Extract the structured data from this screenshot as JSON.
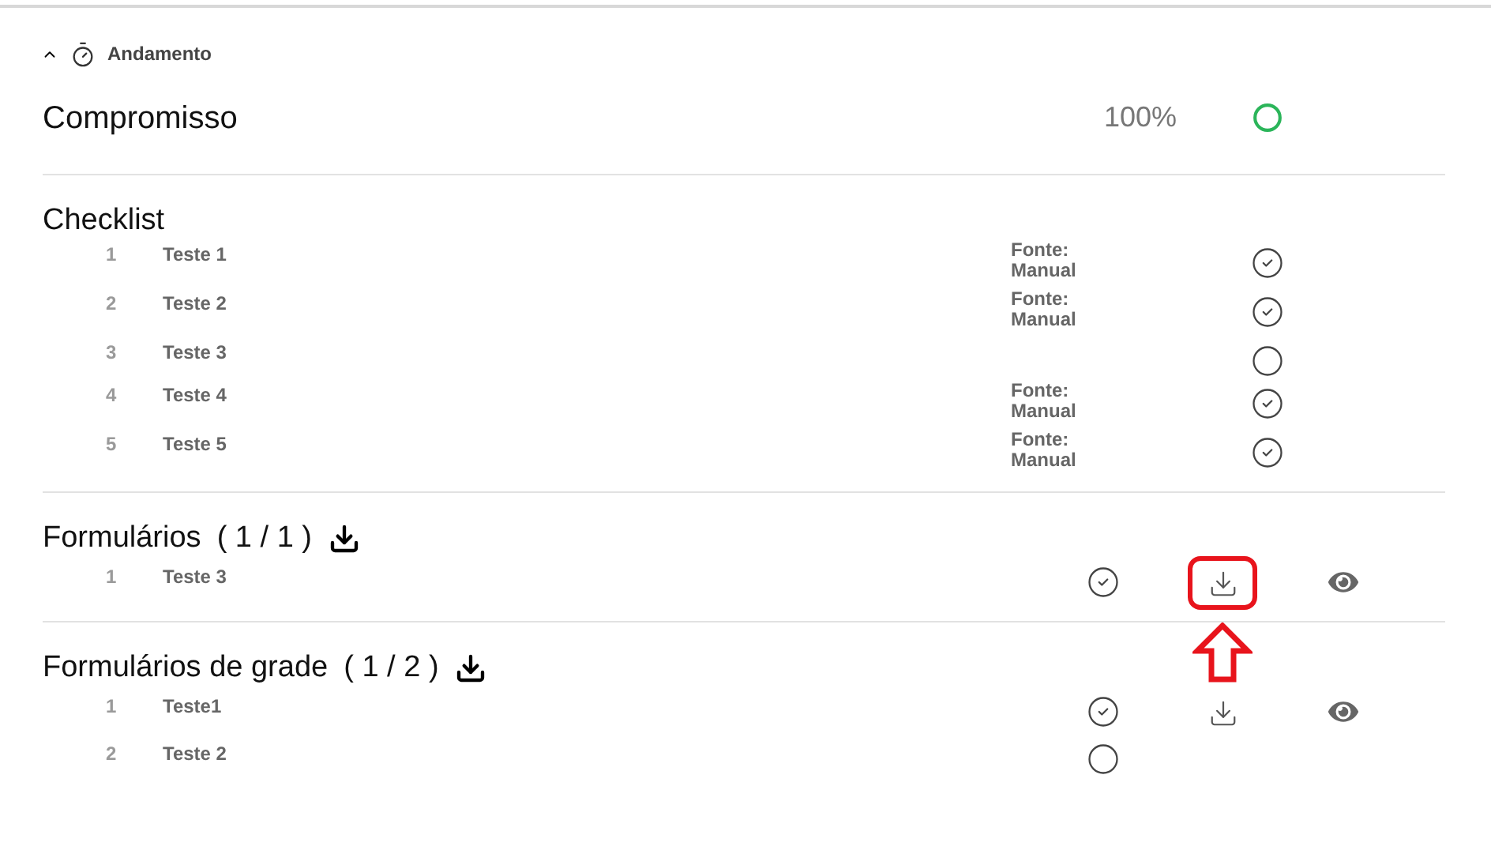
{
  "section": {
    "title": "Andamento",
    "expanded": true
  },
  "commitment": {
    "title": "Compromisso",
    "percent": "100%",
    "complete": true
  },
  "checklist": {
    "title": "Checklist",
    "items": [
      {
        "number": "1",
        "name": "Teste 1",
        "source_label": "Fonte:",
        "source": "Manual",
        "checked": true
      },
      {
        "number": "2",
        "name": "Teste 2",
        "source_label": "Fonte:",
        "source": "Manual",
        "checked": true
      },
      {
        "number": "3",
        "name": "Teste 3",
        "checked": false
      },
      {
        "number": "4",
        "name": "Teste 4",
        "source_label": "Fonte:",
        "source": "Manual",
        "checked": true
      },
      {
        "number": "5",
        "name": "Teste 5",
        "source_label": "Fonte:",
        "source": "Manual",
        "checked": true
      }
    ]
  },
  "form_groups": [
    {
      "title": "Formulários",
      "count": "( 1 / 1 )",
      "items": [
        {
          "number": "1",
          "name": "Teste 3",
          "completed": true,
          "downloadable": true,
          "viewable": true,
          "highlighted": true
        }
      ]
    },
    {
      "title": "Formulários de grade",
      "count": "( 1 / 2 )",
      "items": [
        {
          "number": "1",
          "name": "Teste1",
          "completed": true,
          "downloadable": true,
          "viewable": true,
          "highlighted": false
        },
        {
          "number": "2",
          "name": "Teste 2",
          "completed": false,
          "downloadable": false,
          "viewable": false
        }
      ]
    }
  ]
}
